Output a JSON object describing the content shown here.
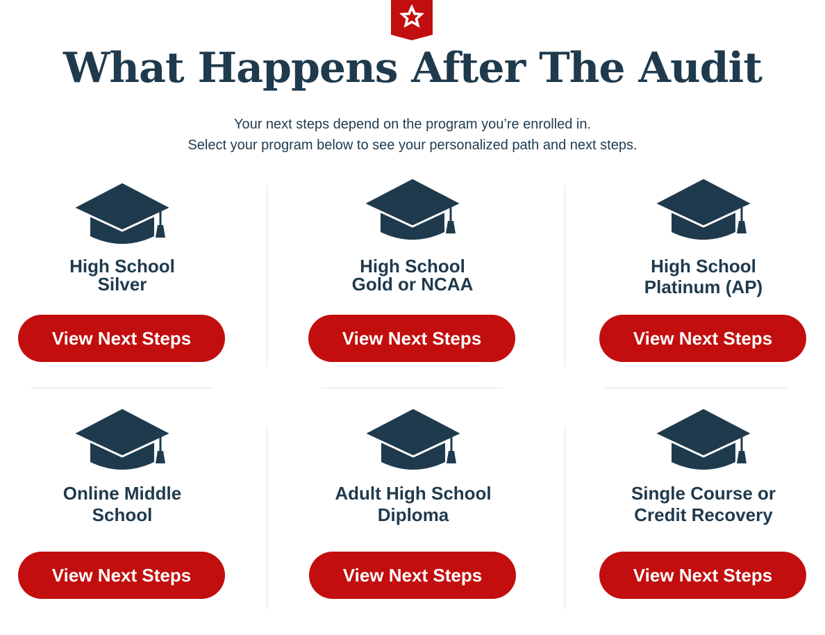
{
  "header": {
    "title": "What Happens After The Audit",
    "subtitle_line1": "Your next steps depend on the program you’re enrolled in.",
    "subtitle_line2": "Select your program below to see your personalized path and next steps."
  },
  "brand": {
    "logo_icon": "star-shield-logo",
    "accent_color": "#c20e0e",
    "text_color": "#1f3a4d"
  },
  "programs": [
    {
      "title_line1": "High School",
      "title_line2": "Silver",
      "button_label": "View Next Steps",
      "icon": "graduation-cap-icon"
    },
    {
      "title_line1": "High School",
      "title_line2": "Gold or NCAA",
      "button_label": "View Next Steps",
      "icon": "graduation-cap-icon"
    },
    {
      "title_line1": "High School",
      "title_line2": "Platinum (AP)",
      "button_label": "View Next Steps",
      "icon": "graduation-cap-icon"
    },
    {
      "title_line1": "Online Middle",
      "title_line2": "School",
      "button_label": "View Next Steps",
      "icon": "graduation-cap-icon"
    },
    {
      "title_line1": "Adult High School",
      "title_line2": "Diploma",
      "button_label": "View Next Steps",
      "icon": "graduation-cap-icon"
    },
    {
      "title_line1": "Single Course or",
      "title_line2": "Credit Recovery",
      "button_label": "View Next Steps",
      "icon": "graduation-cap-icon"
    }
  ]
}
